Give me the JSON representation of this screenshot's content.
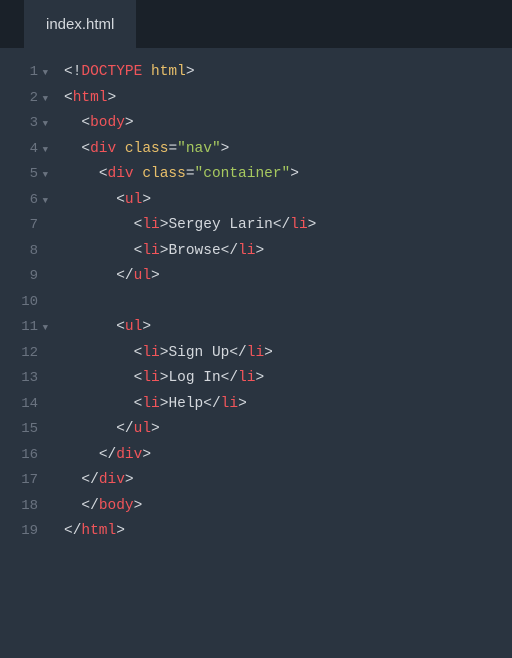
{
  "tab": {
    "filename": "index.html"
  },
  "gutter": {
    "lines": [
      {
        "n": "1",
        "fold": true
      },
      {
        "n": "2",
        "fold": true
      },
      {
        "n": "3",
        "fold": true
      },
      {
        "n": "4",
        "fold": true
      },
      {
        "n": "5",
        "fold": true
      },
      {
        "n": "6",
        "fold": true
      },
      {
        "n": "7",
        "fold": false
      },
      {
        "n": "8",
        "fold": false
      },
      {
        "n": "9",
        "fold": false
      },
      {
        "n": "10",
        "fold": false
      },
      {
        "n": "11",
        "fold": true
      },
      {
        "n": "12",
        "fold": false
      },
      {
        "n": "13",
        "fold": false
      },
      {
        "n": "14",
        "fold": false
      },
      {
        "n": "15",
        "fold": false
      },
      {
        "n": "16",
        "fold": false
      },
      {
        "n": "17",
        "fold": false
      },
      {
        "n": "18",
        "fold": false
      },
      {
        "n": "19",
        "fold": false
      }
    ]
  },
  "code": {
    "lines": [
      {
        "indent": "",
        "tokens": [
          {
            "c": "bracket",
            "t": "<!"
          },
          {
            "c": "doctype-bang",
            "t": "DOCTYPE"
          },
          {
            "c": "bracket",
            "t": " "
          },
          {
            "c": "html-kw",
            "t": "html"
          },
          {
            "c": "bracket",
            "t": ">"
          }
        ]
      },
      {
        "indent": "",
        "tokens": [
          {
            "c": "bracket",
            "t": "<"
          },
          {
            "c": "tag-name",
            "t": "html"
          },
          {
            "c": "bracket",
            "t": ">"
          }
        ]
      },
      {
        "indent": "  ",
        "tokens": [
          {
            "c": "bracket",
            "t": "<"
          },
          {
            "c": "tag-name",
            "t": "body"
          },
          {
            "c": "bracket",
            "t": ">"
          }
        ]
      },
      {
        "indent": "  ",
        "tokens": [
          {
            "c": "bracket",
            "t": "<"
          },
          {
            "c": "tag-name",
            "t": "div"
          },
          {
            "c": "bracket",
            "t": " "
          },
          {
            "c": "attr-name",
            "t": "class"
          },
          {
            "c": "attr-eq",
            "t": "="
          },
          {
            "c": "attr-val",
            "t": "\"nav\""
          },
          {
            "c": "bracket",
            "t": ">"
          }
        ]
      },
      {
        "indent": "    ",
        "tokens": [
          {
            "c": "bracket",
            "t": "<"
          },
          {
            "c": "tag-name",
            "t": "div"
          },
          {
            "c": "bracket",
            "t": " "
          },
          {
            "c": "attr-name",
            "t": "class"
          },
          {
            "c": "attr-eq",
            "t": "="
          },
          {
            "c": "attr-val",
            "t": "\"container\""
          },
          {
            "c": "bracket",
            "t": ">"
          }
        ]
      },
      {
        "indent": "      ",
        "tokens": [
          {
            "c": "bracket",
            "t": "<"
          },
          {
            "c": "tag-name",
            "t": "ul"
          },
          {
            "c": "bracket",
            "t": ">"
          }
        ]
      },
      {
        "indent": "        ",
        "tokens": [
          {
            "c": "bracket",
            "t": "<"
          },
          {
            "c": "tag-name",
            "t": "li"
          },
          {
            "c": "bracket",
            "t": ">"
          },
          {
            "c": "text-content",
            "t": "Sergey Larin"
          },
          {
            "c": "bracket",
            "t": "</"
          },
          {
            "c": "tag-name",
            "t": "li"
          },
          {
            "c": "bracket",
            "t": ">"
          }
        ]
      },
      {
        "indent": "        ",
        "tokens": [
          {
            "c": "bracket",
            "t": "<"
          },
          {
            "c": "tag-name",
            "t": "li"
          },
          {
            "c": "bracket",
            "t": ">"
          },
          {
            "c": "text-content",
            "t": "Browse"
          },
          {
            "c": "bracket",
            "t": "</"
          },
          {
            "c": "tag-name",
            "t": "li"
          },
          {
            "c": "bracket",
            "t": ">"
          }
        ]
      },
      {
        "indent": "      ",
        "tokens": [
          {
            "c": "bracket",
            "t": "</"
          },
          {
            "c": "tag-name",
            "t": "ul"
          },
          {
            "c": "bracket",
            "t": ">"
          }
        ]
      },
      {
        "indent": "",
        "tokens": []
      },
      {
        "indent": "      ",
        "tokens": [
          {
            "c": "bracket",
            "t": "<"
          },
          {
            "c": "tag-name",
            "t": "ul"
          },
          {
            "c": "bracket",
            "t": ">"
          }
        ]
      },
      {
        "indent": "        ",
        "tokens": [
          {
            "c": "bracket",
            "t": "<"
          },
          {
            "c": "tag-name",
            "t": "li"
          },
          {
            "c": "bracket",
            "t": ">"
          },
          {
            "c": "text-content",
            "t": "Sign Up"
          },
          {
            "c": "bracket",
            "t": "</"
          },
          {
            "c": "tag-name",
            "t": "li"
          },
          {
            "c": "bracket",
            "t": ">"
          }
        ]
      },
      {
        "indent": "        ",
        "tokens": [
          {
            "c": "bracket",
            "t": "<"
          },
          {
            "c": "tag-name",
            "t": "li"
          },
          {
            "c": "bracket",
            "t": ">"
          },
          {
            "c": "text-content",
            "t": "Log In"
          },
          {
            "c": "bracket",
            "t": "</"
          },
          {
            "c": "tag-name",
            "t": "li"
          },
          {
            "c": "bracket",
            "t": ">"
          }
        ]
      },
      {
        "indent": "        ",
        "tokens": [
          {
            "c": "bracket",
            "t": "<"
          },
          {
            "c": "tag-name",
            "t": "li"
          },
          {
            "c": "bracket",
            "t": ">"
          },
          {
            "c": "text-content",
            "t": "Help"
          },
          {
            "c": "bracket",
            "t": "</"
          },
          {
            "c": "tag-name",
            "t": "li"
          },
          {
            "c": "bracket",
            "t": ">"
          }
        ]
      },
      {
        "indent": "      ",
        "tokens": [
          {
            "c": "bracket",
            "t": "</"
          },
          {
            "c": "tag-name",
            "t": "ul"
          },
          {
            "c": "bracket",
            "t": ">"
          }
        ]
      },
      {
        "indent": "    ",
        "tokens": [
          {
            "c": "bracket",
            "t": "</"
          },
          {
            "c": "tag-name",
            "t": "div"
          },
          {
            "c": "bracket",
            "t": ">"
          }
        ]
      },
      {
        "indent": "  ",
        "tokens": [
          {
            "c": "bracket",
            "t": "</"
          },
          {
            "c": "tag-name",
            "t": "div"
          },
          {
            "c": "bracket",
            "t": ">"
          }
        ]
      },
      {
        "indent": "  ",
        "tokens": [
          {
            "c": "bracket",
            "t": "</"
          },
          {
            "c": "tag-name",
            "t": "body"
          },
          {
            "c": "bracket",
            "t": ">"
          }
        ]
      },
      {
        "indent": "",
        "tokens": [
          {
            "c": "bracket",
            "t": "</"
          },
          {
            "c": "tag-name",
            "t": "html"
          },
          {
            "c": "bracket",
            "t": ">"
          }
        ]
      }
    ]
  }
}
